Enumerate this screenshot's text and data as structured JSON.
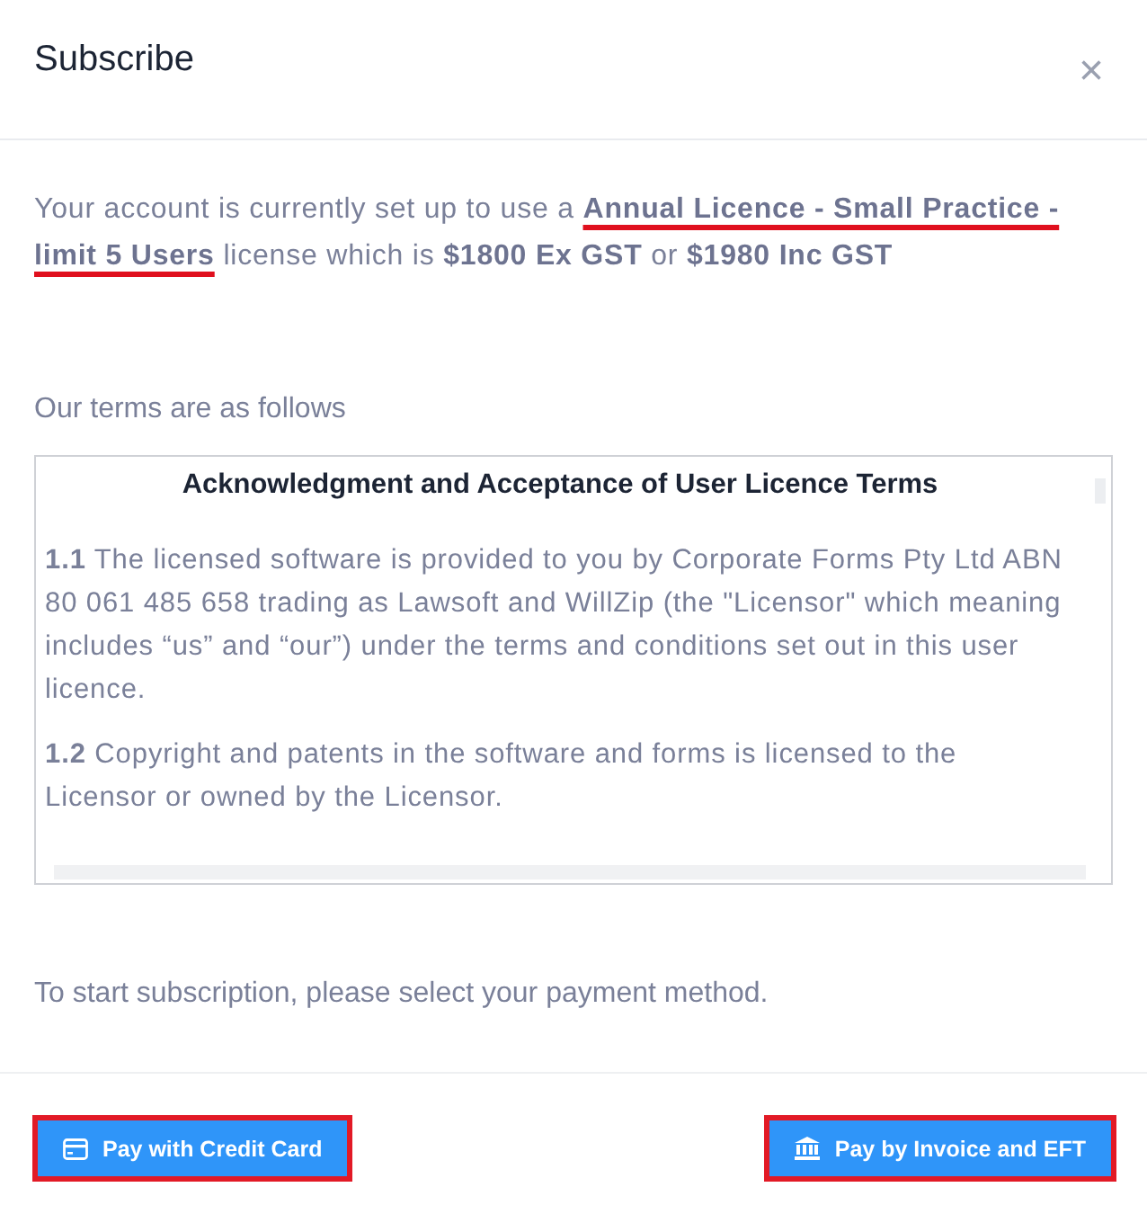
{
  "dialog": {
    "title": "Subscribe",
    "close": "×"
  },
  "intro": {
    "before": "Your account is currently set up to use a ",
    "licence": "Annual Licence - Small Practice - limit 5 Users",
    "licence_marked": true,
    "after": " license which is **$1800 Ex GST** or **$1980 Inc GST**"
  },
  "terms_label": "Our terms are as follows",
  "terms": {
    "heading": "Acknowledgment and Acceptance of User Licence Terms",
    "paragraphs": [
      "**1.1** The licensed software is provided to you by Corporate Forms Pty Ltd ABN 80 061 485 658 trading as Lawsoft and WillZip (the \"Licensor\" which meaning includes “us” and “our”) under the terms and conditions set out in this user licence.",
      "**1.2** Copyright and patents in the software and forms is licensed to the Licensor or owned by the Licensor."
    ]
  },
  "prompt": "To start subscription, please select your payment method.",
  "buttons": [
    {
      "label": "Pay with Credit Card",
      "kind": "card",
      "highlighted": true
    },
    {
      "label": "Pay by Invoice and EFT",
      "kind": "bank",
      "highlighted": true
    }
  ]
}
